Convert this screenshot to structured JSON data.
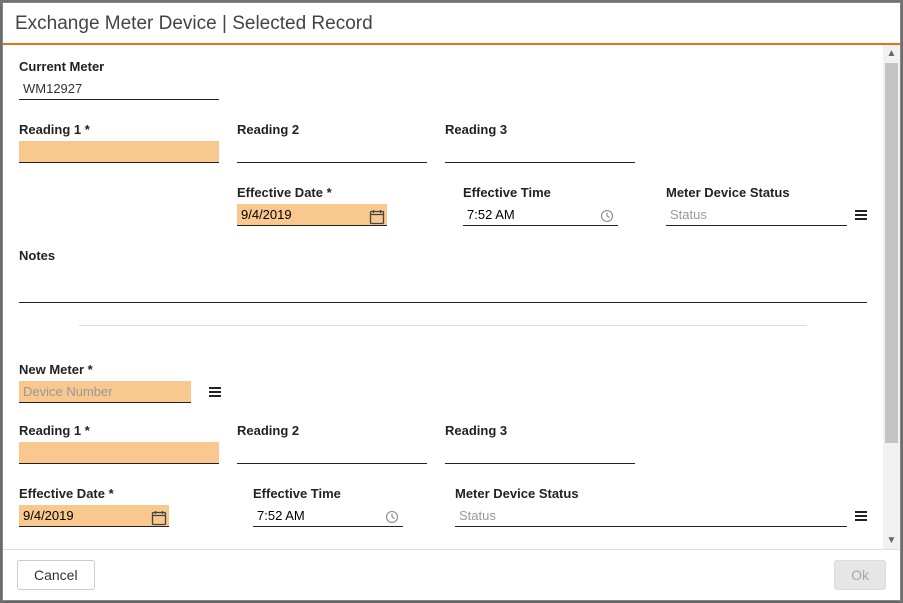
{
  "dialog": {
    "title": "Exchange Meter Device | Selected Record"
  },
  "current": {
    "meter_label": "Current Meter",
    "meter_value": "WM12927",
    "reading1_label": "Reading 1 *",
    "reading1_value": "",
    "reading2_label": "Reading 2",
    "reading2_value": "",
    "reading3_label": "Reading 3",
    "reading3_value": "",
    "eff_date_label": "Effective Date *",
    "eff_date_value": "9/4/2019",
    "eff_time_label": "Effective Time",
    "eff_time_value": "7:52 AM",
    "status_label": "Meter Device Status",
    "status_placeholder": "Status",
    "notes_label": "Notes",
    "notes_value": ""
  },
  "new": {
    "meter_label": "New Meter *",
    "meter_placeholder": "Device Number",
    "reading1_label": "Reading 1 *",
    "reading1_value": "",
    "reading2_label": "Reading 2",
    "reading2_value": "",
    "reading3_label": "Reading 3",
    "reading3_value": "",
    "eff_date_label": "Effective Date *",
    "eff_date_value": "9/4/2019",
    "eff_time_label": "Effective Time",
    "eff_time_value": "7:52 AM",
    "status_label": "Meter Device Status",
    "status_placeholder": "Status"
  },
  "footer": {
    "cancel_label": "Cancel",
    "ok_label": "Ok"
  },
  "colors": {
    "accent": "#e86f1a",
    "required_bg": "#f8c88e"
  }
}
